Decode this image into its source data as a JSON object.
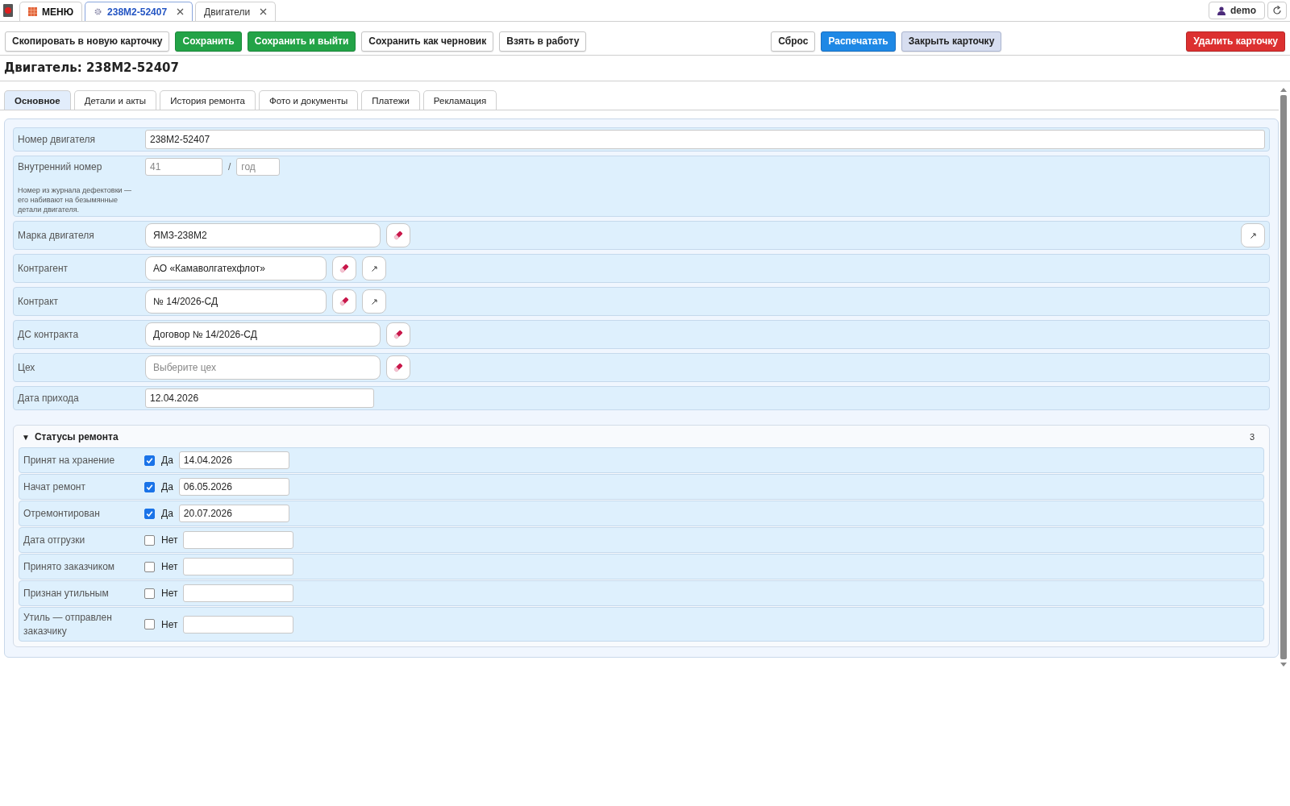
{
  "top_tabs": [
    {
      "kind": "menu",
      "label": "МЕНЮ",
      "selected": false,
      "closable": false
    },
    {
      "kind": "record",
      "label": "238М2-52407",
      "selected": true,
      "closable": true
    },
    {
      "kind": "list",
      "label": "Двигатели",
      "selected": false,
      "closable": true
    }
  ],
  "user": {
    "name": "demo"
  },
  "toolbar": {
    "left": [
      {
        "label": "Скопировать в новую карточку",
        "kind": "plain"
      },
      {
        "label": "Сохранить",
        "kind": "save"
      },
      {
        "label": "Сохранить и выйти",
        "kind": "save"
      },
      {
        "label": "Сохранить как черновик",
        "kind": "plain"
      },
      {
        "label": "Взять в работу",
        "kind": "plain"
      }
    ],
    "center": [
      {
        "label": "Сброс",
        "kind": "plain"
      },
      {
        "label": "Распечатать",
        "kind": "print"
      },
      {
        "label": "Закрыть карточку",
        "kind": "close"
      }
    ],
    "right": [
      {
        "label": "Удалить карточку",
        "kind": "delete"
      }
    ]
  },
  "title": "Двигатель: 238М2-52407",
  "tabs": [
    {
      "label": "Основное",
      "selected": true
    },
    {
      "label": "Детали и акты",
      "selected": false
    },
    {
      "label": "История ремонта",
      "selected": false
    },
    {
      "label": "Фото и документы",
      "selected": false
    },
    {
      "label": "Платежи",
      "selected": false
    },
    {
      "label": "Рекламация",
      "selected": false
    }
  ],
  "fields": [
    {
      "kind": "text",
      "label": "Номер двигателя",
      "value": "238М2-52407"
    },
    {
      "kind": "pair",
      "label": "Внутренний номер",
      "placeholder": "41",
      "separator": "/",
      "placeholder_2": "год",
      "hint": "Номер из журнала дефектовки — его набивают на безымянные детали двигателя."
    },
    {
      "kind": "picker_end_link",
      "label": "Марка двигателя",
      "value": "ЯМЗ-238М2"
    },
    {
      "kind": "picker_link",
      "label": "Контрагент",
      "value": "АО «Камаволгатехфлот»"
    },
    {
      "kind": "picker_link",
      "label": "Контракт",
      "value": "№ 14/2026-СД"
    },
    {
      "kind": "picker",
      "label": "ДС контракта",
      "value": "Договор № 14/2026-СД"
    },
    {
      "kind": "picker",
      "label": "Цех",
      "placeholder": "Выберите цех"
    },
    {
      "kind": "date",
      "label": "Дата прихода",
      "value": "12.04.2026"
    }
  ],
  "statuses": {
    "title": "Статусы ремонта",
    "expanded": true,
    "marker": "▼",
    "count": "3",
    "rows": [
      {
        "label": "Принят на хранение",
        "checked": true,
        "answer": "Да",
        "date": "14.04.2026"
      },
      {
        "label": "Начат ремонт",
        "checked": true,
        "answer": "Да",
        "date": "06.05.2026"
      },
      {
        "label": "Отремонтирован",
        "checked": true,
        "answer": "Да",
        "date": "20.07.2026"
      },
      {
        "label": "Дата отгрузки",
        "checked": false,
        "answer": "Нет"
      },
      {
        "label": "Принято заказчиком",
        "checked": false,
        "answer": "Нет"
      },
      {
        "label": "Признан утильным",
        "checked": false,
        "answer": "Нет"
      },
      {
        "label": "Утиль — отправлен заказчику",
        "checked": false,
        "answer": "Нет"
      }
    ]
  }
}
